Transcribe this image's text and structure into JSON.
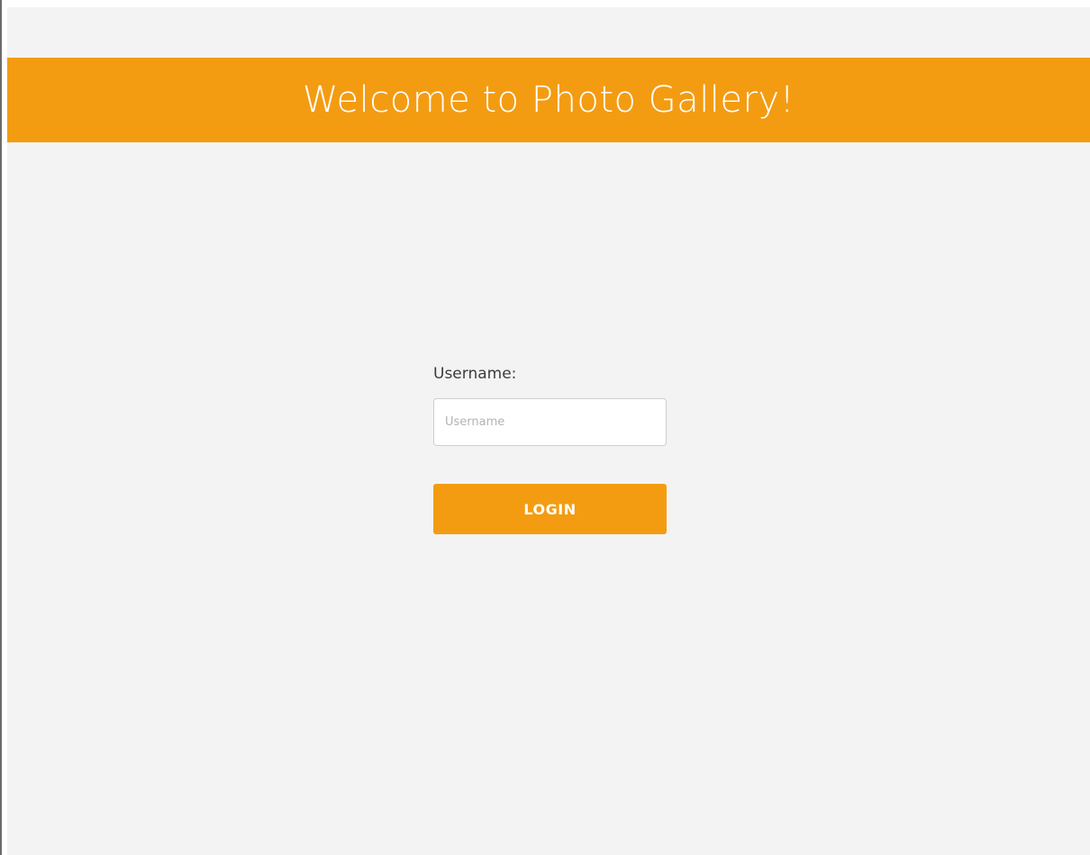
{
  "header": {
    "title": "Welcome to Photo Gallery!"
  },
  "login": {
    "username_label": "Username:",
    "username_placeholder": "Username",
    "username_value": "",
    "button_label": "LOGIN"
  },
  "colors": {
    "accent": "#f39c12",
    "background": "#f4f3f3",
    "input_background": "#ffffff",
    "label_text": "#3c3c3c"
  }
}
